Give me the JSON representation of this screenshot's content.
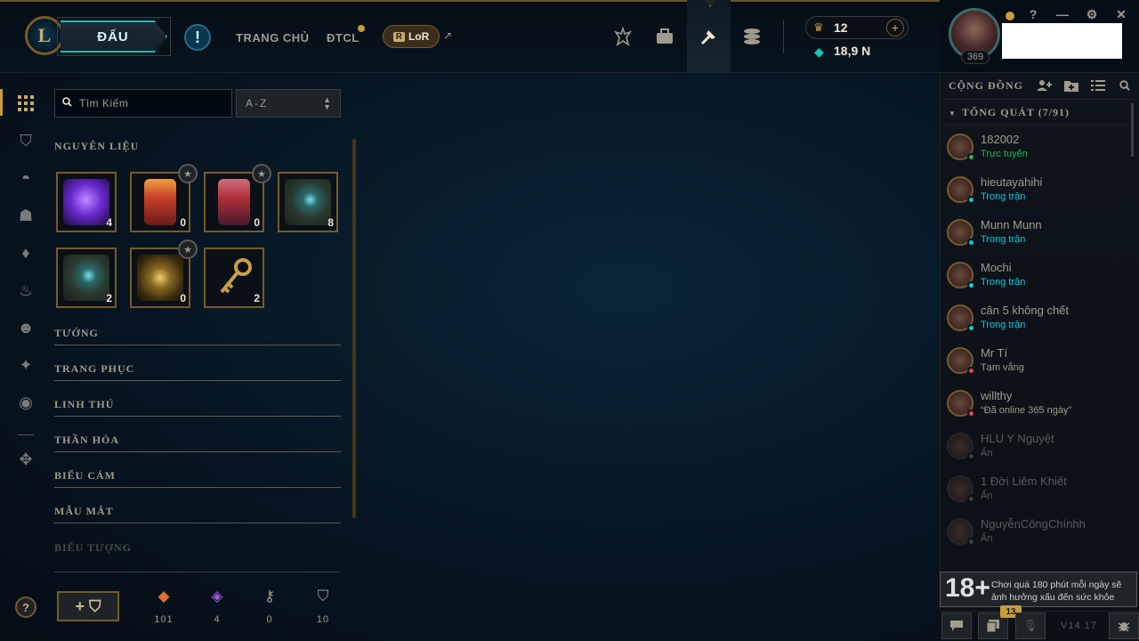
{
  "header": {
    "logo": "L",
    "play_label": "ĐẤU",
    "alert_symbol": "!",
    "nav": [
      "TRANG CHỦ",
      "ĐTCL"
    ],
    "lor_badge": "R",
    "lor_label": "LoR",
    "ext_symbol": "↗"
  },
  "currency": {
    "rp_value": "12",
    "be_value": "18,9 N",
    "add_symbol": "+"
  },
  "profile": {
    "level": "369"
  },
  "window": {
    "help": "?",
    "minimize": "—",
    "settings": "⚙",
    "close": "✕"
  },
  "loot": {
    "search_placeholder": "Tìm Kiếm",
    "sort_value": "A-Z",
    "sort_arrows": "⌃",
    "section_materials": "NGUYÊN LIỆU",
    "tiles": [
      {
        "count": "4",
        "color": "#6a2ad0"
      },
      {
        "count": "0",
        "color": "#c8402a"
      },
      {
        "count": "0",
        "color": "#b0303a"
      },
      {
        "count": "8",
        "color": "#2a4a3a"
      },
      {
        "count": "2",
        "color": "#2a4a3a"
      },
      {
        "count": "0",
        "color": "#8a6a20"
      },
      {
        "count": "2",
        "color": "#a07a2a"
      }
    ],
    "star": "★",
    "sections": [
      "TƯỚNG",
      "TRANG PHỤC",
      "LINH THÚ",
      "THẦN HỎA",
      "BIỂU CẢM",
      "MẪU MẮT"
    ],
    "faded_section": "BIỂU TƯỢNG",
    "craft_label": "+ ⛉",
    "materials": [
      {
        "icon": "◆",
        "value": "101",
        "color": "#e0702a"
      },
      {
        "icon": "◈",
        "value": "4",
        "color": "#a05ad8"
      },
      {
        "icon": "⚷",
        "value": "0",
        "color": "#a09b8c"
      },
      {
        "icon": "⛉",
        "value": "10",
        "color": "#a09b8c"
      }
    ]
  },
  "social": {
    "title": "CỘNG ĐỒNG",
    "group": "TỔNG QUÁT (7/91)",
    "friends": [
      {
        "name": "182002",
        "status": "Trực tuyến",
        "status_color": "#1db954",
        "dot": "#1db954"
      },
      {
        "name": "hieutayahihi",
        "status": "Trong trận",
        "status_color": "#0acbe6",
        "dot": "#0acbe6"
      },
      {
        "name": "Munn Munn",
        "status": "Trong trận",
        "status_color": "#0acbe6",
        "dot": "#0acbe6"
      },
      {
        "name": "Mochi",
        "status": "Trong trận",
        "status_color": "#0acbe6",
        "dot": "#0acbe6"
      },
      {
        "name": "cân 5 không chết",
        "status": "Trong trận",
        "status_color": "#0acbe6",
        "dot": "#0acbe6"
      },
      {
        "name": "Mr Tí",
        "status": "Tạm vắng",
        "status_color": "#a09b8c",
        "dot": "#e84057"
      },
      {
        "name": "willthy",
        "status": "“Đã online 365 ngày”",
        "status_color": "#a09b8c",
        "dot": "#e84057"
      },
      {
        "name": "HLU Y Nguyệt",
        "status": "Ẩn",
        "status_color": "#5b5a56",
        "dot": "#3c3c41"
      },
      {
        "name": "1 Đời Liêm Khiết",
        "status": "Ẩn",
        "status_color": "#5b5a56",
        "dot": "#3c3c41"
      },
      {
        "name": "NguyễnCôngChínhh",
        "status": "Ẩn",
        "status_color": "#5b5a56",
        "dot": "#3c3c41"
      }
    ],
    "age_rating": "18+",
    "age_warning": "Chơi quá 180 phút mỗi ngày sẽ ảnh hưởng xấu đến sức khỏe",
    "notif_count": "13",
    "version": "V14.17"
  }
}
